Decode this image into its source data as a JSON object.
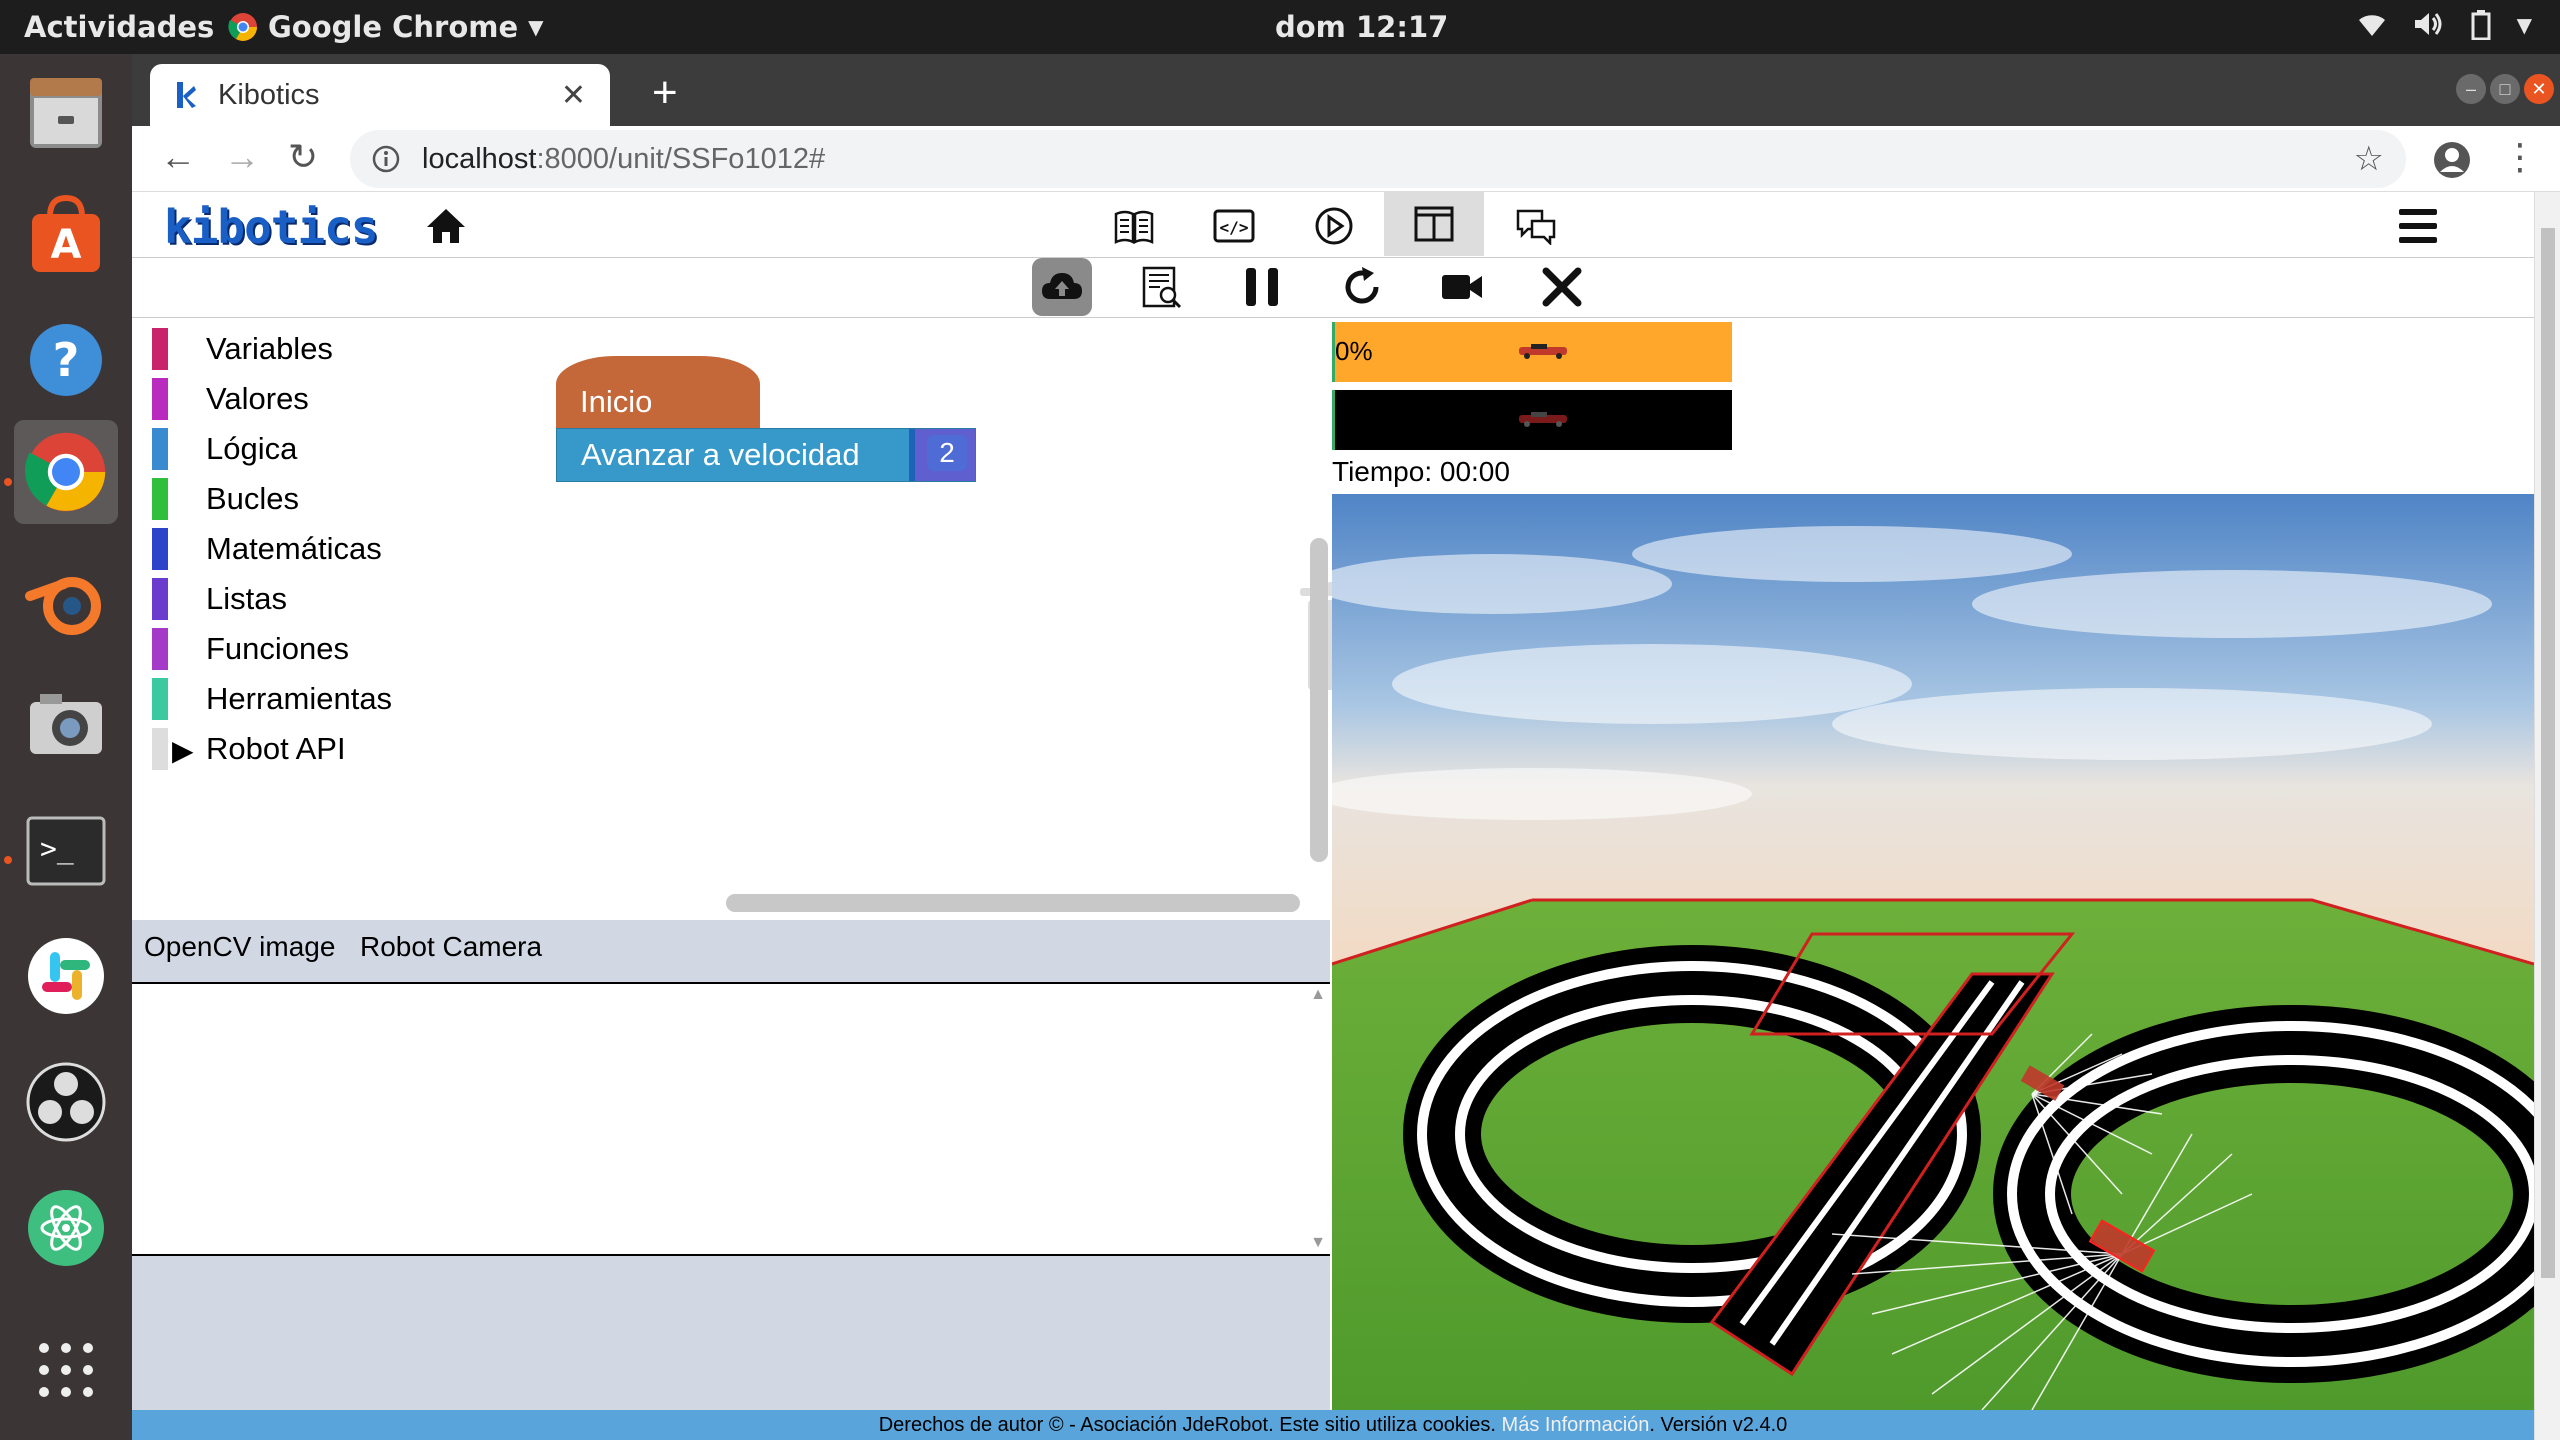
{
  "system": {
    "activities": "Actividades",
    "app_name": "Google Chrome",
    "clock": "dom 12:17"
  },
  "browser": {
    "tab_title": "Kibotics",
    "url_host": "localhost",
    "url_rest": ":8000/unit/SSFo1012#"
  },
  "header": {
    "logo": "kibotics"
  },
  "toolbox": {
    "categories": [
      {
        "label": "Variables",
        "color": "#c9246b"
      },
      {
        "label": "Valores",
        "color": "#b92bbf"
      },
      {
        "label": "Lógica",
        "color": "#3a8ad0"
      },
      {
        "label": "Bucles",
        "color": "#2fbf3a"
      },
      {
        "label": "Matemáticas",
        "color": "#2c44c9"
      },
      {
        "label": "Listas",
        "color": "#6a3bcc"
      },
      {
        "label": "Funciones",
        "color": "#a53ac9"
      },
      {
        "label": "Herramientas",
        "color": "#3ac9a0"
      },
      {
        "label": "Robot API",
        "color": "#dddddd"
      }
    ]
  },
  "blocks": {
    "start": "Inicio",
    "move": "Avanzar a velocidad",
    "speed": "2"
  },
  "camera": {
    "tab_opencv": "OpenCV image",
    "tab_robot": "Robot Camera"
  },
  "simulator": {
    "progress_label": "0%",
    "progress": 0,
    "timer": "Tiempo: 00:00"
  },
  "footer": {
    "text": "Derechos de autor © - Asociación JdeRobot. Este sitio utiliza cookies. ",
    "link": "Más Información",
    "version": ". Versión v2.4.0"
  }
}
